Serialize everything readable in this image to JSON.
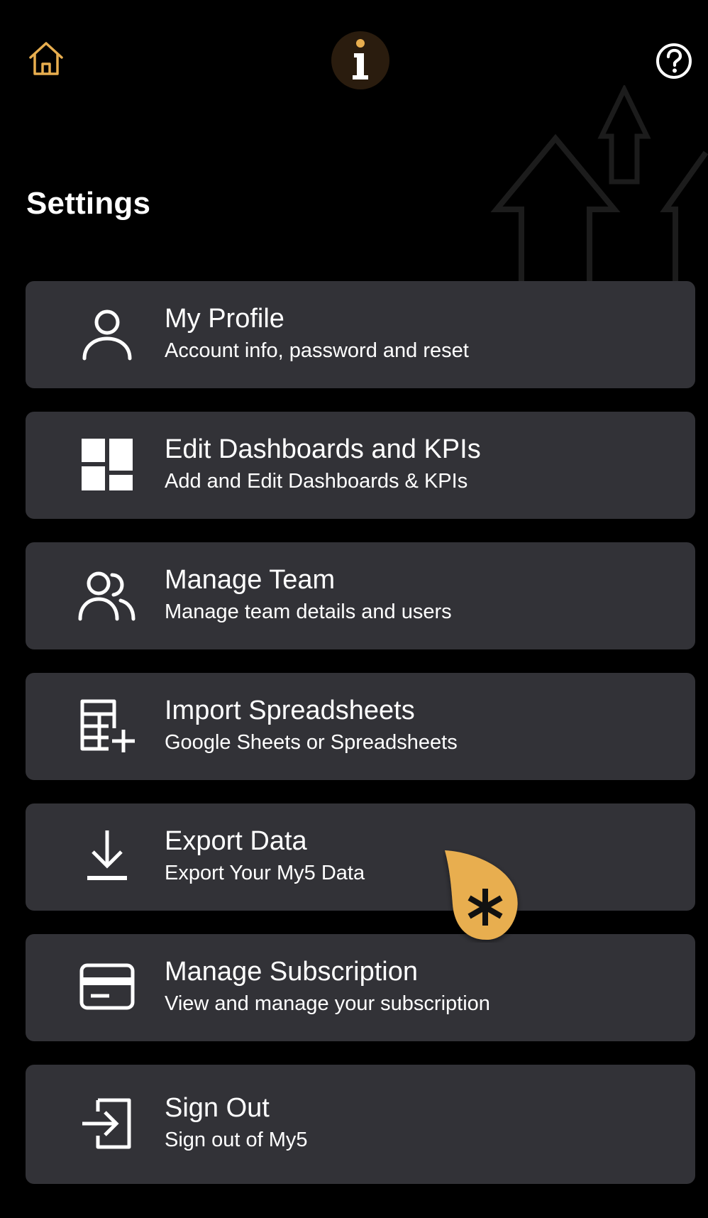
{
  "header": {
    "home_icon": "home-icon",
    "logo_icon": "info-i-logo",
    "help_icon": "question-circle-icon",
    "accent_color": "#E8AE4F"
  },
  "page": {
    "title": "Settings"
  },
  "menu": {
    "items": [
      {
        "icon": "user-icon",
        "title": "My Profile",
        "subtitle": "Account info, password and reset"
      },
      {
        "icon": "dashboard-icon",
        "title": "Edit Dashboards and KPIs",
        "subtitle": "Add and Edit Dashboards & KPIs"
      },
      {
        "icon": "users-icon",
        "title": "Manage Team",
        "subtitle": "Manage team details and users"
      },
      {
        "icon": "table-plus-icon",
        "title": "Import Spreadsheets",
        "subtitle": "Google Sheets or Spreadsheets"
      },
      {
        "icon": "download-icon",
        "title": "Export Data",
        "subtitle": "Export Your My5 Data"
      },
      {
        "icon": "credit-card-icon",
        "title": "Manage Subscription",
        "subtitle": "View and manage your subscription"
      },
      {
        "icon": "sign-in-icon",
        "title": "Sign Out",
        "subtitle": "Sign out of My5"
      }
    ]
  },
  "help_bubble": {
    "icon": "asterisk-icon",
    "color": "#E8AE4F"
  }
}
